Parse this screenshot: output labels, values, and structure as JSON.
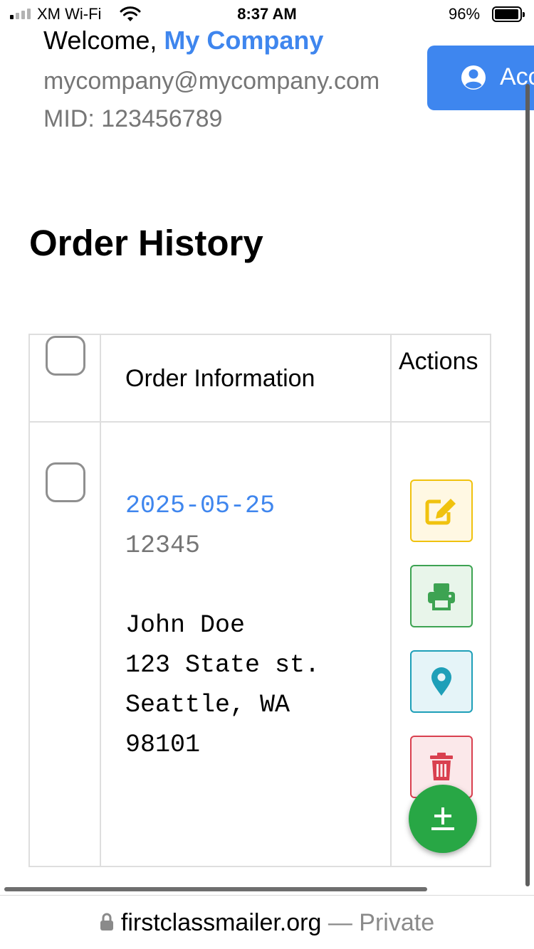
{
  "status_bar": {
    "carrier": "XM Wi-Fi",
    "time": "8:37 AM",
    "battery": "96%",
    "battery_level": 0.96,
    "signal_bars_filled": 1
  },
  "header": {
    "welcome_prefix": "Welcome,",
    "company_name": "My Company",
    "email": "mycompany@mycompany.com",
    "mid": "MID: 123456789",
    "account_button_label": "Acc",
    "account_icon": "user-circle-icon"
  },
  "page": {
    "title": "Order History"
  },
  "table": {
    "headers": {
      "order_information": "Order Information",
      "actions": "Actions"
    },
    "rows": [
      {
        "date": "2025-05-25",
        "order_id": "12345",
        "name": "John Doe",
        "street": "123 State st.",
        "city_state": "Seattle, WA",
        "zip": "98101",
        "checked": false
      }
    ],
    "actions": [
      {
        "name": "edit",
        "icon": "edit-icon",
        "color": "#f0c20e"
      },
      {
        "name": "print",
        "icon": "print-icon",
        "color": "#3da352"
      },
      {
        "name": "map",
        "icon": "map-marker-icon",
        "color": "#1e9fb8"
      },
      {
        "name": "delete",
        "icon": "trash-icon",
        "color": "#d9404f"
      }
    ]
  },
  "fab": {
    "icon": "plus-minus-icon",
    "color": "#28a745"
  },
  "browser": {
    "host": "firstclassmailer.org",
    "suffix": " — Private",
    "icon": "lock-icon"
  },
  "colors": {
    "accent": "#3f86ee",
    "muted": "#767676"
  }
}
